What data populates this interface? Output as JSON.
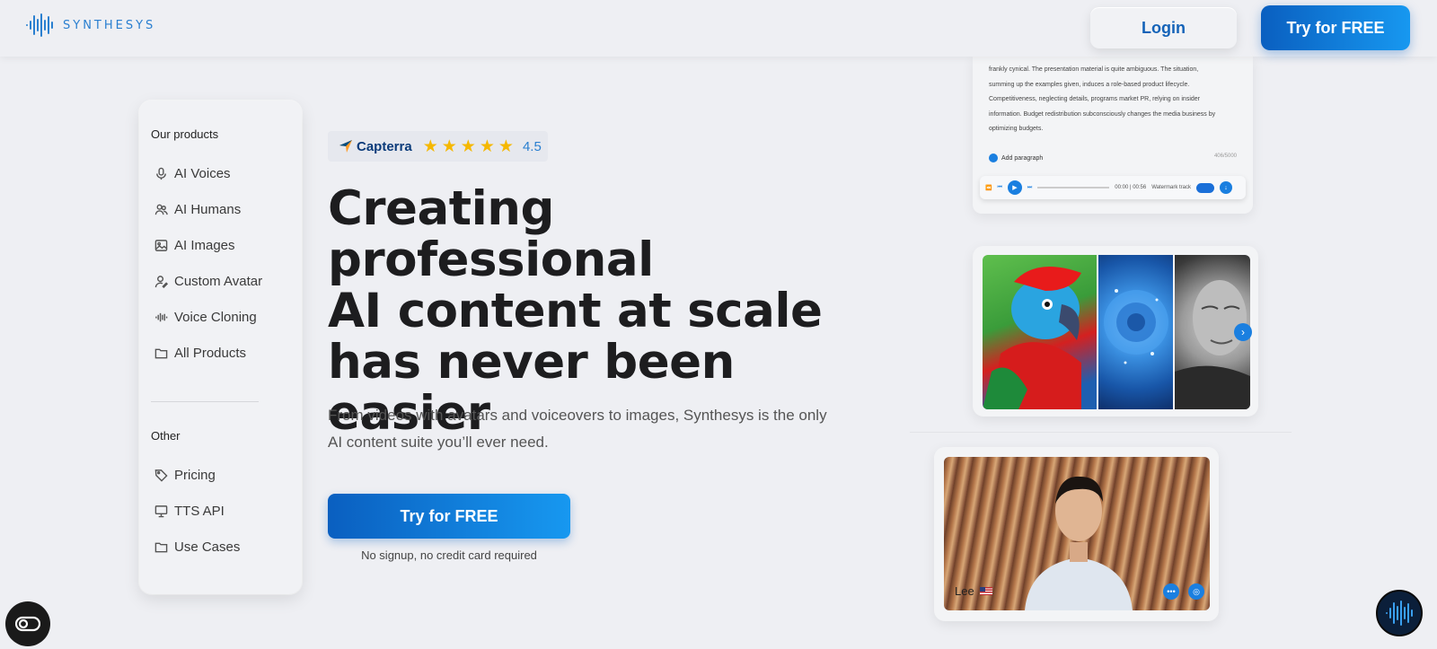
{
  "header": {
    "logo_text": "SYNTHESYS",
    "login_label": "Login",
    "try_label": "Try for FREE"
  },
  "sidebar": {
    "products_heading": "Our products",
    "products": [
      {
        "label": "AI Voices",
        "icon": "microphone-icon"
      },
      {
        "label": "AI Humans",
        "icon": "users-icon"
      },
      {
        "label": "AI Images",
        "icon": "image-icon"
      },
      {
        "label": "Custom Avatar",
        "icon": "user-edit-icon"
      },
      {
        "label": "Voice Cloning",
        "icon": "waveform-icon"
      },
      {
        "label": "All Products",
        "icon": "folder-icon"
      }
    ],
    "other_heading": "Other",
    "other": [
      {
        "label": "Pricing",
        "icon": "tag-icon"
      },
      {
        "label": "TTS API",
        "icon": "monitor-icon"
      },
      {
        "label": "Use Cases",
        "icon": "folder-icon"
      }
    ]
  },
  "capterra": {
    "name": "Capterra",
    "rating": "4.5",
    "stars": 5
  },
  "hero": {
    "title_lines": [
      "Creating professional",
      "AI content at scale",
      "has never been",
      "easier"
    ],
    "subtitle": "From videos with avatars and voiceovers to images, Synthesys is the only AI content suite you’ll ever need.",
    "cta_label": "Try for FREE",
    "note": "No signup, no credit card required"
  },
  "editor": {
    "text_lines": [
      "frankly cynical. The presentation material is quite ambiguous. The situation,",
      "summing up the examples given, induces a role-based product lifecycle.",
      "Competitiveness, neglecting details, programs market PR,  relying on insider",
      "information. Budget redistribution subconsciously changes the media business by",
      "optimizing budgets."
    ],
    "add_paragraph": "Add paragraph",
    "char_count": "406/5000",
    "time": "00:00 | 00:56",
    "watermark": "Watermark track"
  },
  "avatar": {
    "name": "Lee"
  },
  "colors": {
    "brand_blue": "#1463b8",
    "cta_gradient_start": "#0a5fc0",
    "cta_gradient_end": "#1798f0",
    "background": "#eeeff3"
  }
}
